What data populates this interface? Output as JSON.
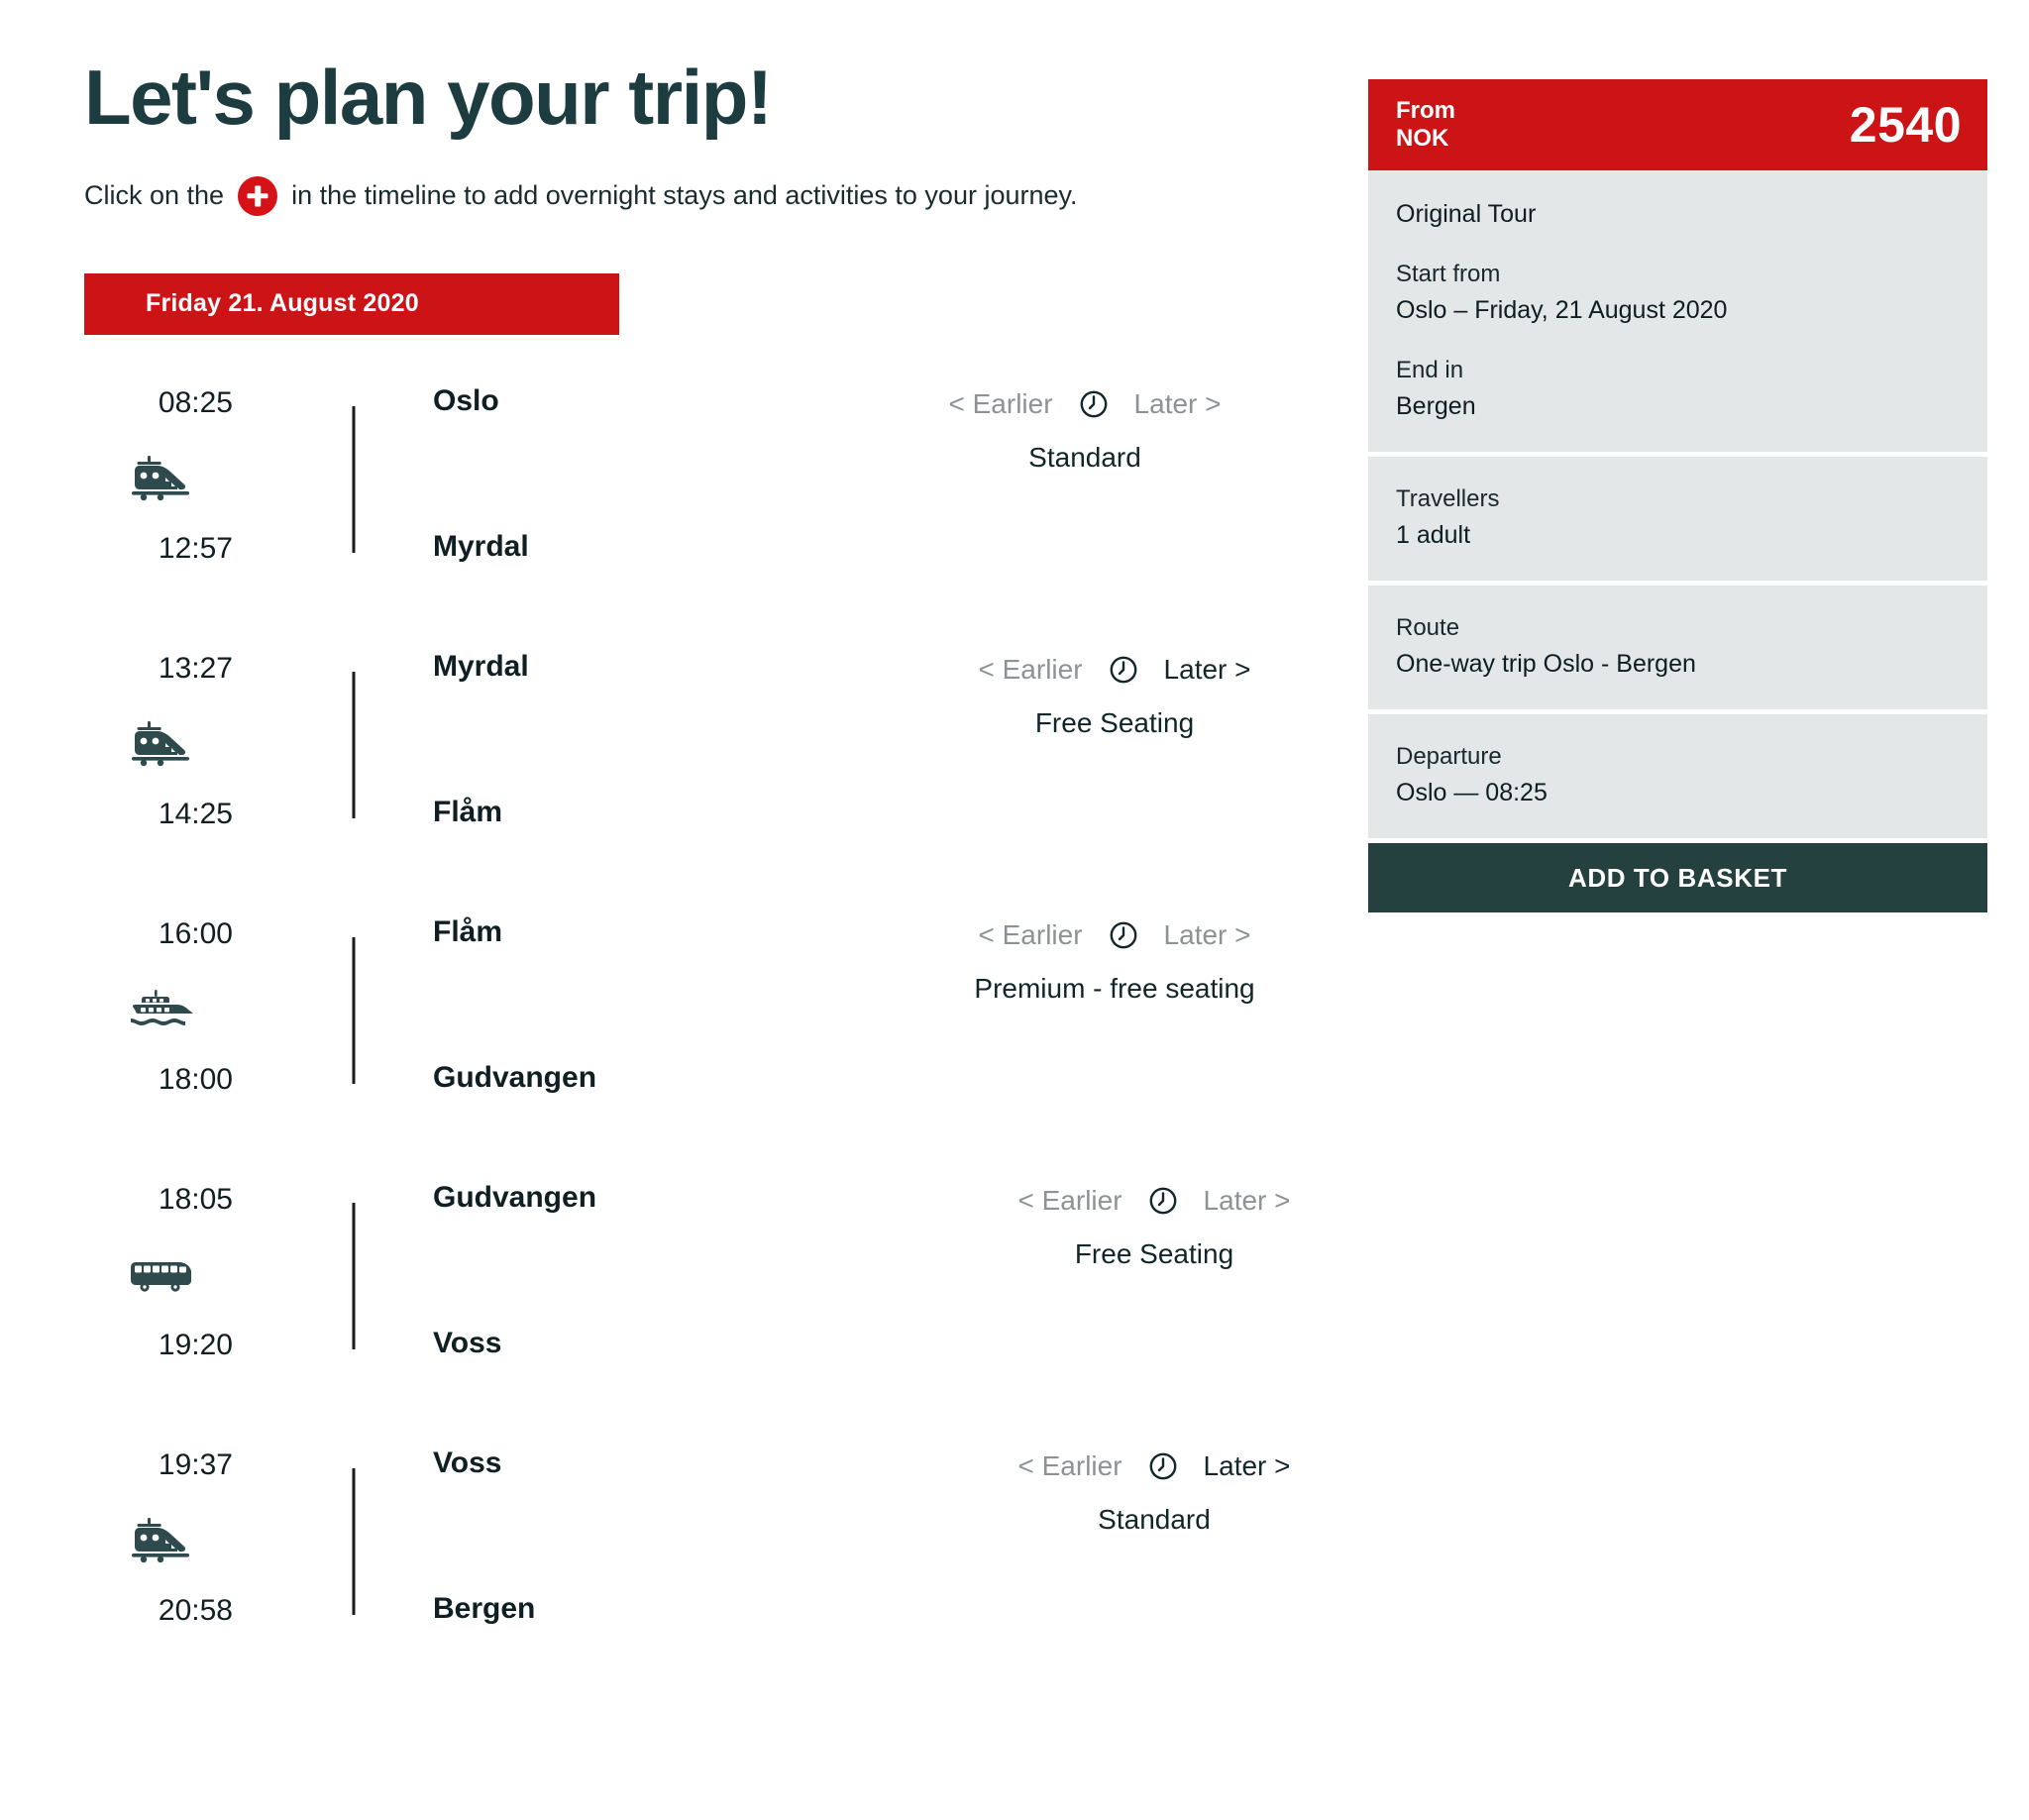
{
  "header": {
    "title": "Let's plan your trip!",
    "subtitle_before": "Click on the",
    "subtitle_after": "in the timeline to add overnight stays and activities to your journey.",
    "plus_icon": "plus-circle-icon"
  },
  "date_banner": {
    "label": "Friday 21. August 2020"
  },
  "controls_labels": {
    "earlier": "< Earlier",
    "later": "Later >",
    "clock_icon": "clock-icon"
  },
  "segments": [
    {
      "departure_time": "08:25",
      "departure_station": "Oslo",
      "arrival_time": "12:57",
      "arrival_station": "Myrdal",
      "mode_icon": "train-icon",
      "earlier_label": "< Earlier",
      "later_label": "Later >",
      "earlier_enabled": false,
      "later_enabled": false,
      "class_label": "Standard"
    },
    {
      "departure_time": "13:27",
      "departure_station": "Myrdal",
      "arrival_time": "14:25",
      "arrival_station": "Flåm",
      "mode_icon": "train-icon",
      "earlier_label": "< Earlier",
      "later_label": "Later >",
      "earlier_enabled": false,
      "later_enabled": true,
      "class_label": "Free Seating"
    },
    {
      "departure_time": "16:00",
      "departure_station": "Flåm",
      "arrival_time": "18:00",
      "arrival_station": "Gudvangen",
      "mode_icon": "ferry-icon",
      "earlier_label": "< Earlier",
      "later_label": "Later >",
      "earlier_enabled": false,
      "later_enabled": false,
      "class_label": "Premium - free seating"
    },
    {
      "departure_time": "18:05",
      "departure_station": "Gudvangen",
      "arrival_time": "19:20",
      "arrival_station": "Voss",
      "mode_icon": "bus-icon",
      "earlier_label": "< Earlier",
      "later_label": "Later >",
      "earlier_enabled": false,
      "later_enabled": false,
      "class_label": "Free Seating"
    },
    {
      "departure_time": "19:37",
      "departure_station": "Voss",
      "arrival_time": "20:58",
      "arrival_station": "Bergen",
      "mode_icon": "train-icon",
      "earlier_label": "< Earlier",
      "later_label": "Later >",
      "earlier_enabled": false,
      "later_enabled": true,
      "class_label": "Standard"
    }
  ],
  "sidebar": {
    "price_from_line1": "From",
    "price_from_line2": "NOK",
    "price_amount": "2540",
    "tour_name": "Original Tour",
    "start_label": "Start from",
    "start_value": "Oslo – Friday, 21 August 2020",
    "end_label": "End in",
    "end_value": "Bergen",
    "travellers_label": "Travellers",
    "travellers_value": "1 adult",
    "route_label": "Route",
    "route_value": "One-way trip Oslo - Bergen",
    "departure_label": "Departure",
    "departure_value": "Oslo — 08:25",
    "add_to_basket": "ADD TO BASKET"
  },
  "colors": {
    "brand_red": "#cc1417",
    "node_red": "#d41217",
    "dark_teal": "#25413f",
    "panel_grey": "#e3e7e7",
    "muted_text": "#8d9296"
  }
}
